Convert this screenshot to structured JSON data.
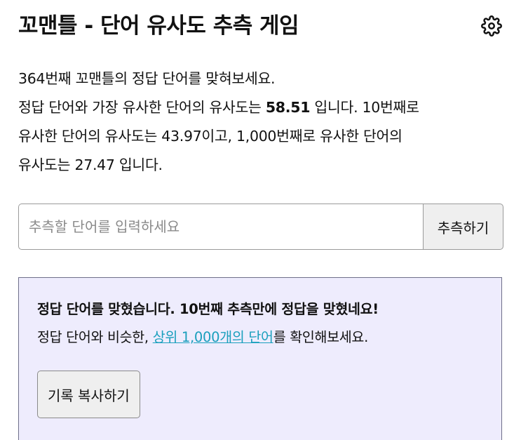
{
  "header": {
    "title": "꼬맨틀 - 단어 유사도 추측 게임",
    "settings_icon": "gear-icon"
  },
  "intro": {
    "line1": "364번째 꼬맨틀의 정답 단어를 맞혀보세요.",
    "line2_prefix": "정답 단어와 가장 유사한 단어의 유사도는 ",
    "top_similarity": "58.51",
    "line2_suffix": " 입니다. 10번째로",
    "line3": "유사한 단어의 유사도는 43.97이고, 1,000번째로 유사한 단어의",
    "line4": "유사도는 27.47 입니다."
  },
  "guess": {
    "placeholder": "추측할 단어를 입력하세요",
    "value": "",
    "button_label": "추측하기"
  },
  "result": {
    "title": "정답 단어를 맞혔습니다. 10번째 추측만에 정답을 맞혔네요!",
    "line_prefix": "정답 단어와 비슷한, ",
    "link_text": "상위 1,000개의 단어",
    "line_suffix": "를 확인해보세요.",
    "copy_button_label": "기록 복사하기"
  },
  "colors": {
    "result_background": "#eeecfd",
    "link": "#1a9fbd",
    "button_background": "#efefef"
  }
}
